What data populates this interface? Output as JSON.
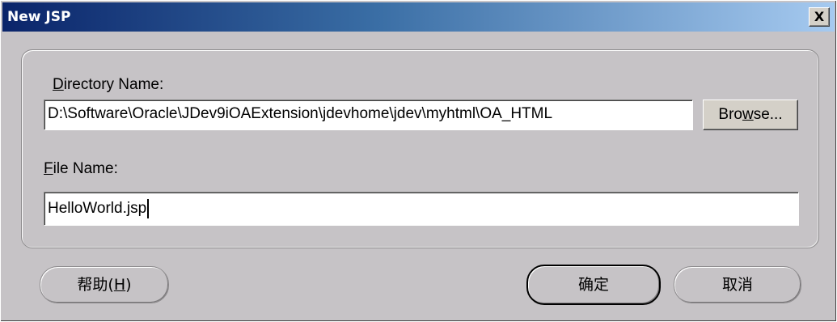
{
  "window": {
    "title": "New JSP",
    "close_symbol": "X"
  },
  "directory": {
    "label_accel": "D",
    "label_rest": "irectory Name:",
    "value": "D:\\Software\\Oracle\\JDev9iOAExtension\\jdevhome\\jdev\\myhtml\\OA_HTML",
    "browse_pre": "Bro",
    "browse_accel": "w",
    "browse_post": "se..."
  },
  "file": {
    "label_accel": "F",
    "label_rest": "ile Name:",
    "value": "HelloWorld.jsp"
  },
  "buttons": {
    "help_pre": "帮助(",
    "help_accel": "H",
    "help_post": ")",
    "ok": "确定",
    "cancel": "取消"
  },
  "icons": {
    "close": "close-icon",
    "caret": "text-caret"
  }
}
